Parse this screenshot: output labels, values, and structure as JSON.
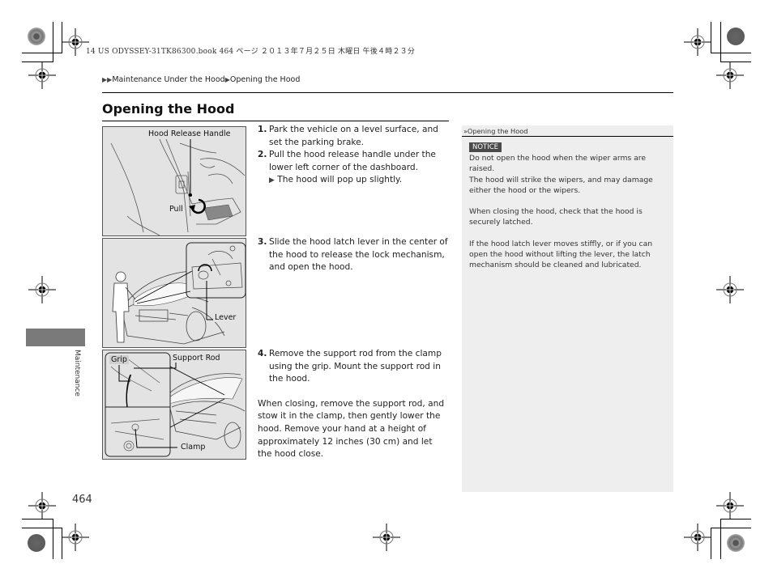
{
  "print_header": "14 US ODYSSEY-31TK86300.book  464 ページ  ２０１３年７月２５日  木曜日  午後４時２３分",
  "breadcrumb": {
    "separator_icon": "▶",
    "items": [
      "Maintenance Under the Hood",
      "Opening the Hood"
    ]
  },
  "page": {
    "title": "Opening the Hood",
    "number": "464",
    "section_tab": "Maintenance"
  },
  "figures": [
    {
      "name": "hood-release-handle-figure",
      "labels": [
        "Hood Release Handle",
        "Pull"
      ]
    },
    {
      "name": "hood-latch-lever-figure",
      "labels": [
        "Lever"
      ]
    },
    {
      "name": "support-rod-figure",
      "labels": [
        "Grip",
        "Support Rod",
        "Clamp"
      ]
    }
  ],
  "steps": [
    {
      "num": "1.",
      "text": "Park the vehicle on a level surface, and set the parking brake."
    },
    {
      "num": "2.",
      "text": "Pull the hood release handle under the lower left corner of the dashboard.",
      "result_icon": "▶",
      "result": "The hood will pop up slightly."
    },
    {
      "num": "3.",
      "text": "Slide the hood latch lever in the center of the hood to release the lock mechanism, and open the hood."
    },
    {
      "num": "4.",
      "text": "Remove the support rod from the clamp using the grip. Mount the support rod in the hood."
    }
  ],
  "closing_text": "When closing, remove the support rod, and stow it in the clamp, then gently lower the hood. Remove your hand at a height of approximately 12 inches (30 cm) and let the hood close.",
  "side_note": {
    "ref_icon": "»",
    "heading": "Opening the Hood",
    "notice_label": "NOTICE",
    "paragraphs": [
      "Do not open the hood when the wiper arms are raised.",
      "The hood will strike the wipers, and may damage either the hood or the wipers.",
      "When closing the hood, check that the hood is securely latched.",
      "If the hood latch lever moves stiffly, or if you can open the hood without lifting the lever, the latch mechanism should be cleaned and lubricated."
    ]
  },
  "colors": {
    "side_panel_bg": "#eeeeee",
    "figure_bg": "#e3e3e3",
    "notice_bg": "#4a4a4a",
    "section_tab": "#7a7a7a"
  }
}
